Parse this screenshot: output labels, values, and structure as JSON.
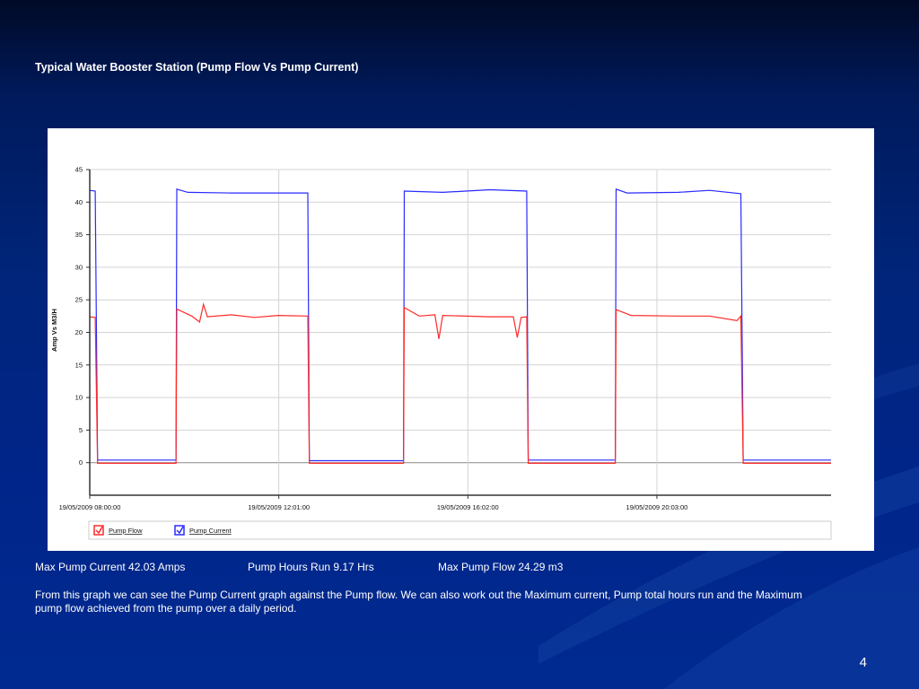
{
  "slide": {
    "title": "Typical Water Booster Station (Pump Flow Vs Pump Current)",
    "stats": {
      "max_current": "Max Pump Current 42.03 Amps",
      "hours_run": "Pump Hours Run 9.17 Hrs",
      "max_flow": "Max Pump Flow 24.29 m3"
    },
    "description": "From this graph we can see the Pump Current graph against the Pump flow. We can also work out the Maximum current, Pump total hours run and the Maximum pump flow achieved from the pump over a daily period.",
    "page_number": "4"
  },
  "colors": {
    "flow": "#ff2a2a",
    "current": "#2a2aff",
    "grid": "#d4d4d4"
  },
  "chart_data": {
    "type": "line",
    "title": "",
    "ylabel": "Amp Vs M3/H",
    "xlabel": "",
    "ylim": [
      -5,
      45
    ],
    "yticks": [
      0,
      5,
      10,
      15,
      20,
      25,
      30,
      35,
      40,
      45
    ],
    "xlim": [
      "19/05/2009 08:00:00",
      "19/05/2009 23:45:00"
    ],
    "xticks": [
      "19/05/2009 08:00:00",
      "19/05/2009 12:01:00",
      "19/05/2009 16:02:00",
      "19/05/2009 20:03:00"
    ],
    "grid": true,
    "legend_position": "bottom",
    "series": [
      {
        "name": "Pump Current",
        "color": "#2a2aff",
        "points": [
          [
            "19/05/2009 08:00",
            41.8
          ],
          [
            "19/05/2009 08:07",
            41.7
          ],
          [
            "19/05/2009 08:10",
            0.4
          ],
          [
            "19/05/2009 09:50",
            0.4
          ],
          [
            "19/05/2009 09:51",
            42.0
          ],
          [
            "19/05/2009 10:05",
            41.5
          ],
          [
            "19/05/2009 11:00",
            41.4
          ],
          [
            "19/05/2009 12:38",
            41.4
          ],
          [
            "19/05/2009 12:40",
            0.3
          ],
          [
            "19/05/2009 14:40",
            0.3
          ],
          [
            "19/05/2009 14:41",
            41.7
          ],
          [
            "19/05/2009 15:30",
            41.5
          ],
          [
            "19/05/2009 16:30",
            41.9
          ],
          [
            "19/05/2009 17:17",
            41.7
          ],
          [
            "19/05/2009 17:19",
            0.4
          ],
          [
            "19/05/2009 19:10",
            0.4
          ],
          [
            "19/05/2009 19:11",
            42.0
          ],
          [
            "19/05/2009 19:25",
            41.4
          ],
          [
            "19/05/2009 20:30",
            41.5
          ],
          [
            "19/05/2009 21:10",
            41.8
          ],
          [
            "19/05/2009 21:50",
            41.3
          ],
          [
            "19/05/2009 21:53",
            0.4
          ],
          [
            "19/05/2009 23:45",
            0.4
          ]
        ]
      },
      {
        "name": "Pump Flow",
        "color": "#ff2a2a",
        "points": [
          [
            "19/05/2009 08:00",
            22.4
          ],
          [
            "19/05/2009 08:07",
            22.3
          ],
          [
            "19/05/2009 08:10",
            -0.1
          ],
          [
            "19/05/2009 09:50",
            -0.1
          ],
          [
            "19/05/2009 09:51",
            23.6
          ],
          [
            "19/05/2009 10:10",
            22.5
          ],
          [
            "19/05/2009 10:20",
            21.6
          ],
          [
            "19/05/2009 10:25",
            24.3
          ],
          [
            "19/05/2009 10:30",
            22.4
          ],
          [
            "19/05/2009 11:00",
            22.7
          ],
          [
            "19/05/2009 11:30",
            22.3
          ],
          [
            "19/05/2009 12:00",
            22.6
          ],
          [
            "19/05/2009 12:38",
            22.5
          ],
          [
            "19/05/2009 12:40",
            -0.1
          ],
          [
            "19/05/2009 14:40",
            -0.1
          ],
          [
            "19/05/2009 14:41",
            23.8
          ],
          [
            "19/05/2009 15:00",
            22.5
          ],
          [
            "19/05/2009 15:20",
            22.7
          ],
          [
            "19/05/2009 15:25",
            19.0
          ],
          [
            "19/05/2009 15:30",
            22.6
          ],
          [
            "19/05/2009 16:30",
            22.4
          ],
          [
            "19/05/2009 17:00",
            22.4
          ],
          [
            "19/05/2009 17:05",
            19.2
          ],
          [
            "19/05/2009 17:10",
            22.3
          ],
          [
            "19/05/2009 17:17",
            22.4
          ],
          [
            "19/05/2009 17:19",
            -0.1
          ],
          [
            "19/05/2009 19:10",
            -0.1
          ],
          [
            "19/05/2009 19:11",
            23.5
          ],
          [
            "19/05/2009 19:30",
            22.6
          ],
          [
            "19/05/2009 20:30",
            22.5
          ],
          [
            "19/05/2009 21:10",
            22.5
          ],
          [
            "19/05/2009 21:45",
            21.8
          ],
          [
            "19/05/2009 21:50",
            22.5
          ],
          [
            "19/05/2009 21:53",
            -0.1
          ],
          [
            "19/05/2009 23:45",
            -0.1
          ]
        ]
      }
    ]
  }
}
